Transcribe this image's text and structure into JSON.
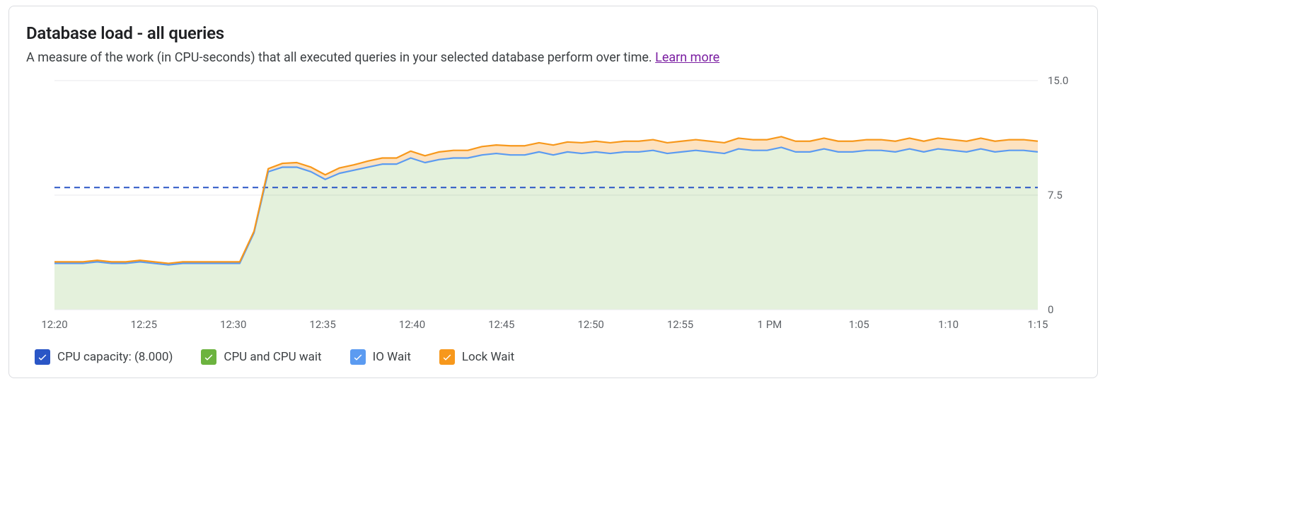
{
  "title": "Database load - all queries",
  "subtitle_text": "A measure of the work (in CPU-seconds) that all executed queries in your selected database perform over time. ",
  "learn_more_label": "Learn more",
  "legend": {
    "cpu_capacity": {
      "label": "CPU capacity: (8.000)",
      "color": "#2a56c6"
    },
    "cpu_wait": {
      "label": "CPU and CPU wait",
      "color": "#6cb33f"
    },
    "io_wait": {
      "label": "IO Wait",
      "color": "#5b9bf1"
    },
    "lock_wait": {
      "label": "Lock Wait",
      "color": "#f7981c"
    }
  },
  "chart_data": {
    "type": "area",
    "title": "Database load - all queries",
    "xlabel": "",
    "ylabel": "",
    "ylim": [
      0,
      15
    ],
    "y_ticks": [
      0,
      7.5,
      15.0
    ],
    "x_categories": [
      "12:20",
      "12:25",
      "12:30",
      "12:35",
      "12:40",
      "12:45",
      "12:50",
      "12:55",
      "1 PM",
      "1:05",
      "1:10",
      "1:15"
    ],
    "cpu_capacity": 8.0,
    "series": [
      {
        "name": "CPU and CPU wait",
        "color": "#6cb33f",
        "values": [
          3.0,
          3.0,
          3.0,
          3.1,
          3.0,
          3.0,
          3.1,
          3.0,
          2.9,
          3.0,
          3.0,
          3.0,
          3.0,
          3.0,
          5.0,
          9.0,
          9.3,
          9.3,
          9.0,
          8.5,
          8.9,
          9.1,
          9.3,
          9.5,
          9.5,
          9.9,
          9.6,
          9.8,
          9.9,
          9.9,
          10.1,
          10.2,
          10.1,
          10.1,
          10.3,
          10.1,
          10.3,
          10.2,
          10.3,
          10.2,
          10.3,
          10.3,
          10.4,
          10.2,
          10.3,
          10.4,
          10.3,
          10.2,
          10.5,
          10.4,
          10.4,
          10.6,
          10.3,
          10.3,
          10.5,
          10.3,
          10.3,
          10.4,
          10.4,
          10.3,
          10.5,
          10.3,
          10.5,
          10.4,
          10.3,
          10.5,
          10.3,
          10.4,
          10.4,
          10.3
        ]
      },
      {
        "name": "IO Wait",
        "color": "#5b9bf1",
        "values": [
          0.03,
          0.03,
          0.03,
          0.03,
          0.03,
          0.03,
          0.03,
          0.03,
          0.03,
          0.03,
          0.03,
          0.03,
          0.03,
          0.03,
          0.03,
          0.03,
          0.03,
          0.03,
          0.03,
          0.03,
          0.03,
          0.03,
          0.03,
          0.03,
          0.03,
          0.03,
          0.03,
          0.03,
          0.03,
          0.03,
          0.03,
          0.03,
          0.03,
          0.03,
          0.03,
          0.03,
          0.03,
          0.03,
          0.03,
          0.03,
          0.03,
          0.03,
          0.03,
          0.03,
          0.03,
          0.03,
          0.03,
          0.03,
          0.03,
          0.03,
          0.03,
          0.03,
          0.03,
          0.03,
          0.03,
          0.03,
          0.03,
          0.03,
          0.03,
          0.03,
          0.03,
          0.03,
          0.03,
          0.03,
          0.03,
          0.03,
          0.03,
          0.03,
          0.03,
          0.03
        ]
      },
      {
        "name": "Lock Wait",
        "color": "#f7981c",
        "values": [
          0.1,
          0.1,
          0.1,
          0.1,
          0.1,
          0.1,
          0.1,
          0.1,
          0.1,
          0.1,
          0.1,
          0.1,
          0.1,
          0.1,
          0.1,
          0.2,
          0.25,
          0.3,
          0.3,
          0.3,
          0.35,
          0.35,
          0.4,
          0.4,
          0.4,
          0.45,
          0.45,
          0.5,
          0.5,
          0.5,
          0.55,
          0.55,
          0.6,
          0.6,
          0.6,
          0.65,
          0.65,
          0.7,
          0.7,
          0.7,
          0.7,
          0.7,
          0.7,
          0.7,
          0.7,
          0.7,
          0.7,
          0.7,
          0.7,
          0.7,
          0.7,
          0.7,
          0.7,
          0.7,
          0.7,
          0.7,
          0.7,
          0.7,
          0.7,
          0.7,
          0.7,
          0.7,
          0.7,
          0.7,
          0.7,
          0.7,
          0.7,
          0.7,
          0.7,
          0.7
        ]
      }
    ],
    "note": "x sampling is ~every 50s; 70 samples across the 12 labeled ticks",
    "x_start_minutes": 0,
    "x_end_minutes": 57
  },
  "colors": {
    "grid": "#e8eaed",
    "dashed": "#2a56c6",
    "area_fill": "rgba(108,179,63,0.18)",
    "lock_fill": "rgba(247,152,28,0.28)",
    "axis_label": "#5f6368"
  }
}
